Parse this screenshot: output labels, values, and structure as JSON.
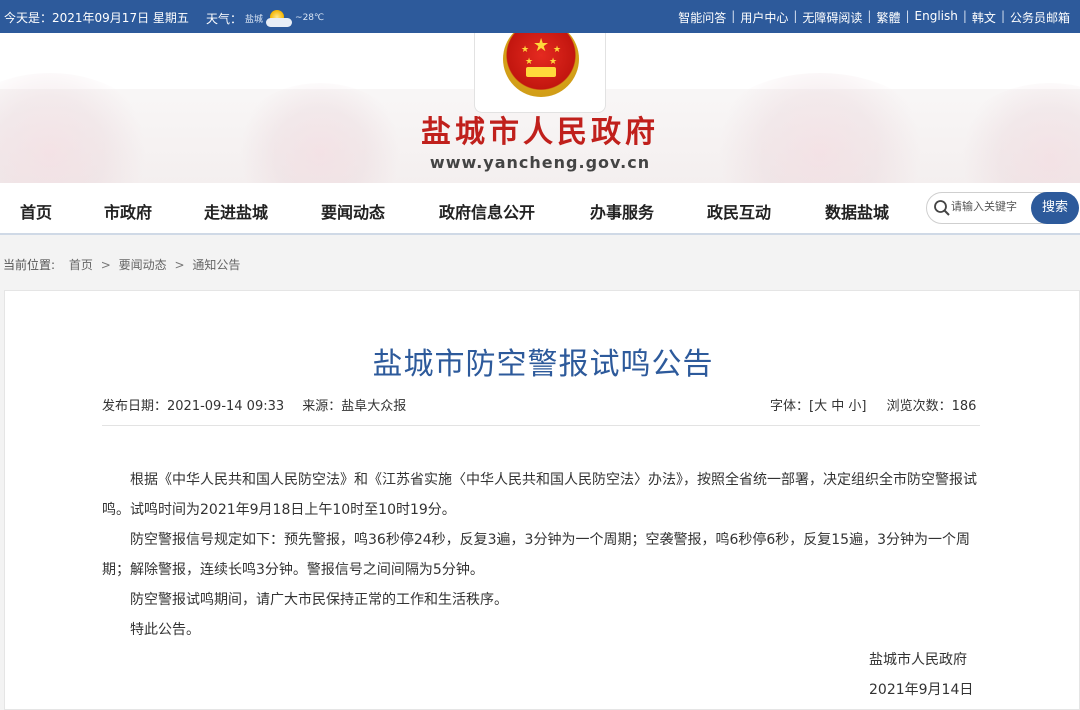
{
  "topbar": {
    "date": "今天是：2021年09月17日 星期五",
    "weather_label": "天气：",
    "weather_city": "盐城",
    "weather_temp": "~28℃",
    "links": [
      "智能问答",
      "用户中心",
      "无障碍阅读",
      "繁體",
      "English",
      "韩文",
      "公务员邮箱"
    ]
  },
  "banner": {
    "title": "盐城市人民政府",
    "url": "www.yancheng.gov.cn"
  },
  "nav": {
    "items": [
      "首页",
      "市政府",
      "走进盐城",
      "要闻动态",
      "政府信息公开",
      "办事服务",
      "政民互动",
      "数据盐城"
    ],
    "search_placeholder": "请输入关键字",
    "search_button": "搜索"
  },
  "breadcrumb": {
    "label": "当前位置:",
    "items": [
      "首页",
      "要闻动态",
      "通知公告"
    ],
    "sep": ">"
  },
  "article": {
    "title": "盐城市防空警报试鸣公告",
    "publish_date": "发布日期：2021-09-14 09:33",
    "source": "来源：盐阜大众报",
    "font_label": "字体：[大 中 小]",
    "views": "浏览次数：186",
    "paragraphs": [
      "根据《中华人民共和国人民防空法》和《江苏省实施〈中华人民共和国人民防空法〉办法》，按照全省统一部署，决定组织全市防空警报试鸣。试鸣时间为2021年9月18日上午10时至10时19分。",
      "防空警报信号规定如下：预先警报，鸣36秒停24秒，反复3遍，3分钟为一个周期；空袭警报，鸣6秒停6秒，反复15遍，3分钟为一个周期；解除警报，连续长鸣3分钟。警报信号之间间隔为5分钟。",
      "防空警报试鸣期间，请广大市民保持正常的工作和生活秩序。",
      "特此公告。"
    ],
    "signature": "盐城市人民政府",
    "sign_date": "2021年9月14日"
  },
  "colors": {
    "brand_blue": "#2d5a9b",
    "title_red": "#c0201c"
  }
}
